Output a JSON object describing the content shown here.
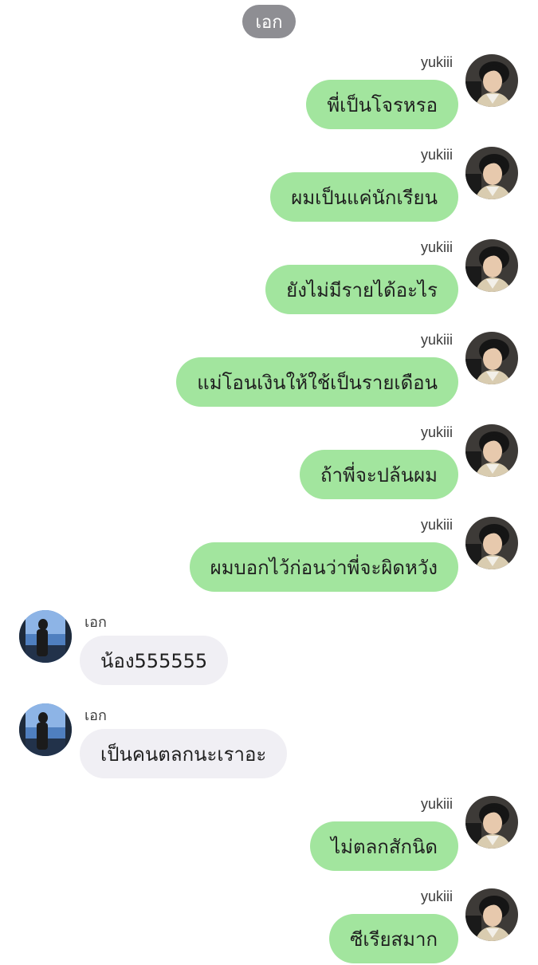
{
  "chat": {
    "header_name": "เอก",
    "messages": [
      {
        "direction": "outgoing",
        "sender": "yukiii",
        "text": "พี่เป็นโจรหรอ"
      },
      {
        "direction": "outgoing",
        "sender": "yukiii",
        "text": "ผมเป็นแค่นักเรียน"
      },
      {
        "direction": "outgoing",
        "sender": "yukiii",
        "text": "ยังไม่มีรายได้อะไร"
      },
      {
        "direction": "outgoing",
        "sender": "yukiii",
        "text": "แม่โอนเงินให้ใช้เป็นรายเดือน"
      },
      {
        "direction": "outgoing",
        "sender": "yukiii",
        "text": "ถ้าพี่จะปล้นผม"
      },
      {
        "direction": "outgoing",
        "sender": "yukiii",
        "text": "ผมบอกไว้ก่อนว่าพี่จะผิดหวัง"
      },
      {
        "direction": "incoming",
        "sender": "เอก",
        "text": "น้อง555555"
      },
      {
        "direction": "incoming",
        "sender": "เอก",
        "text": "เป็นคนตลกนะเราอะ"
      },
      {
        "direction": "outgoing",
        "sender": "yukiii",
        "text": "ไม่ตลกสักนิด"
      },
      {
        "direction": "outgoing",
        "sender": "yukiii",
        "text": "ซีเรียสมาก"
      }
    ]
  },
  "colors": {
    "outgoing_bubble": "#a2e59e",
    "incoming_bubble": "#f0eff4",
    "header_pill": "#8e8e93"
  }
}
